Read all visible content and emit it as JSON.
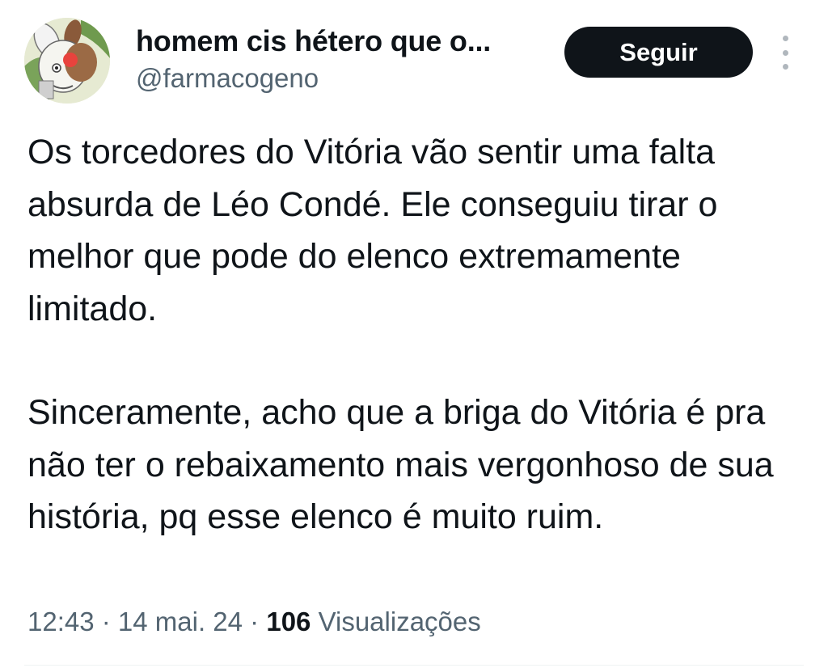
{
  "author": {
    "display_name": "homem cis hétero que o...",
    "handle": "@farmacogeno",
    "avatar_icon": "cartoon-rabbit-avatar-icon"
  },
  "actions": {
    "follow_label": "Seguir",
    "more_icon": "more-options-icon"
  },
  "tweet": {
    "paragraphs": [
      "Os torcedores do Vitória vão sentir uma falta absurda de Léo Condé. Ele conseguiu tirar o melhor que pode do elenco extremamente limitado.",
      "Sinceramente, acho que a briga do Vitória é pra não ter o rebaixamento mais vergonhoso de sua história, pq esse elenco é muito ruim."
    ]
  },
  "meta": {
    "time": "12:43",
    "separator": " · ",
    "date": "14 mai. 24",
    "views_count": "106",
    "views_label": "Visualizações"
  },
  "colors": {
    "text_primary": "#0f1419",
    "text_secondary": "#536471",
    "button_bg": "#0f1419",
    "button_text": "#ffffff"
  }
}
